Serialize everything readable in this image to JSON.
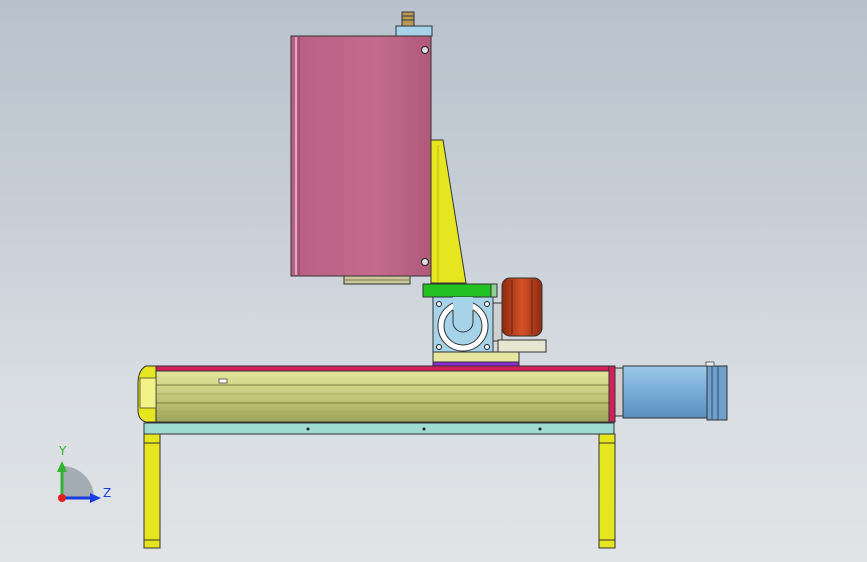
{
  "app": {
    "title": ""
  },
  "viewport": {
    "background_top": "#b8c2cd",
    "background_bottom": "#e1e4e6"
  },
  "triad": {
    "y_label": "Y",
    "z_label": "Z",
    "y_color": "#2fb52f",
    "z_color": "#1a3de0",
    "x_color": "#e02020"
  },
  "colors": {
    "housing": "#c0698a",
    "bracket": "#e6e620",
    "gearbox": "#a6d3e8",
    "motor_body": "#7cb0d8",
    "rail_body": "#c9cf86",
    "base_frame": "#9fdbd3",
    "carriage": "#8a2bd0",
    "green_plate": "#23c223",
    "brake": "#c2431c",
    "red_strip": "#d2215a"
  }
}
